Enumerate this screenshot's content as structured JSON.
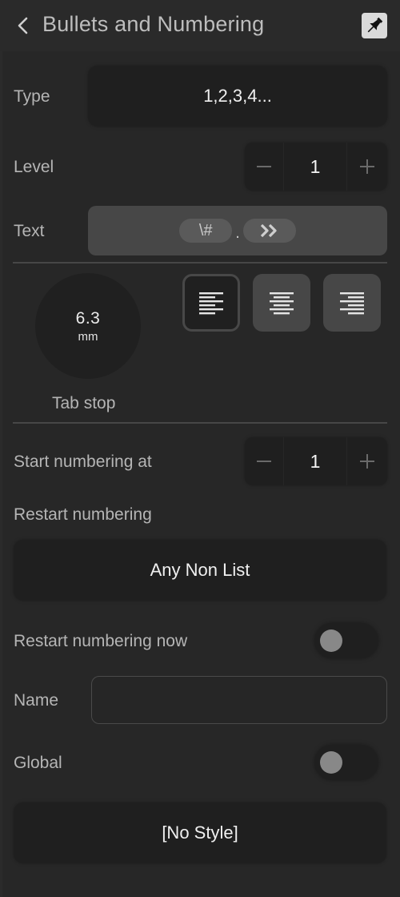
{
  "header": {
    "back_icon": "chevron-left-icon",
    "title": "Bullets and Numbering",
    "pin_icon": "pushpin-icon"
  },
  "type": {
    "label": "Type",
    "value": "1,2,3,4..."
  },
  "level": {
    "label": "Level",
    "value": "1",
    "decrement": "−",
    "increment": "+"
  },
  "text": {
    "label": "Text",
    "tokens": {
      "number": "\\#",
      "separator": ".",
      "tab": "»"
    }
  },
  "tab_stop": {
    "value": "6.3",
    "unit": "mm",
    "label": "Tab stop",
    "alignments": [
      {
        "name": "align-left",
        "icon": "align-left-icon",
        "selected": true
      },
      {
        "name": "align-center",
        "icon": "align-center-icon",
        "selected": false
      },
      {
        "name": "align-right",
        "icon": "align-right-icon",
        "selected": false
      }
    ]
  },
  "start_numbering": {
    "label": "Start numbering at",
    "value": "1",
    "decrement": "−",
    "increment": "+"
  },
  "restart_numbering": {
    "label": "Restart numbering",
    "value": "Any Non List"
  },
  "restart_now": {
    "label": "Restart numbering now",
    "on": false
  },
  "name": {
    "label": "Name",
    "value": "",
    "placeholder": ""
  },
  "global": {
    "label": "Global",
    "on": false
  },
  "style": {
    "value": "[No Style]"
  },
  "colors": {
    "background": "#272727",
    "control_dark": "#1f1f1f",
    "control_mid": "#474747",
    "pin_bg": "#dadada",
    "toggle_knob": "#888888"
  }
}
